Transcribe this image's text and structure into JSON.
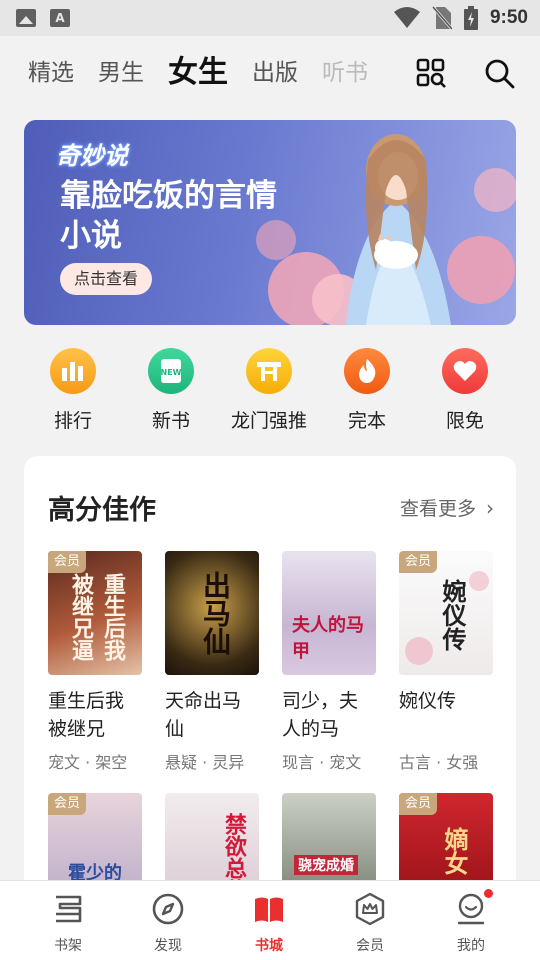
{
  "status_bar": {
    "time": "9:50"
  },
  "tabs": [
    {
      "label": "精选"
    },
    {
      "label": "男生"
    },
    {
      "label": "女生"
    },
    {
      "label": "出版"
    },
    {
      "label": "听书"
    }
  ],
  "banner": {
    "logo": "奇妙说",
    "title": "靠脸吃饭的言情小说",
    "button": "点击查看"
  },
  "categories": [
    {
      "label": "排行",
      "icon": "bar-chart-icon",
      "color": "#f7a21b"
    },
    {
      "label": "新书",
      "icon": "new-book-icon",
      "color": "#2fc48a"
    },
    {
      "label": "龙门强推",
      "icon": "gate-icon",
      "color": "#f7b80f"
    },
    {
      "label": "完本",
      "icon": "flame-icon",
      "color": "#f66a1e"
    },
    {
      "label": "限免",
      "icon": "heart-icon",
      "color": "#f24b4b"
    }
  ],
  "section": {
    "title": "高分佳作",
    "more": "查看更多"
  },
  "vip_label": "会员",
  "books": [
    {
      "title": "重生后我被继兄逼…",
      "tags": "宠文 · 架空",
      "vip": true,
      "cover_text": "重生后我被继兄逼"
    },
    {
      "title": "天命出马仙",
      "tags": "悬疑 · 灵异",
      "vip": false,
      "cover_text": "出马仙"
    },
    {
      "title": "司少，夫人的马甲…",
      "tags": "现言 · 宠文",
      "vip": false,
      "cover_text": "夫人的马甲"
    },
    {
      "title": "婉仪传",
      "tags": "古言 · 女强",
      "vip": true,
      "cover_text": "婉仪传"
    },
    {
      "title": "",
      "tags": "",
      "vip": true,
      "cover_text": "霍少的"
    },
    {
      "title": "",
      "tags": "",
      "vip": false,
      "cover_text": "禁欲总裁"
    },
    {
      "title": "",
      "tags": "",
      "vip": false,
      "cover_text": "骁宠成婚"
    },
    {
      "title": "",
      "tags": "",
      "vip": true,
      "cover_text": "嫡女"
    }
  ],
  "bottom_nav": [
    {
      "label": "书架",
      "icon": "bookshelf-icon"
    },
    {
      "label": "发现",
      "icon": "compass-icon"
    },
    {
      "label": "书城",
      "icon": "bookstore-icon"
    },
    {
      "label": "会员",
      "icon": "crown-badge-icon"
    },
    {
      "label": "我的",
      "icon": "profile-icon"
    }
  ],
  "colors": {
    "accent": "#e9302f",
    "vip": "#c8a77d"
  }
}
